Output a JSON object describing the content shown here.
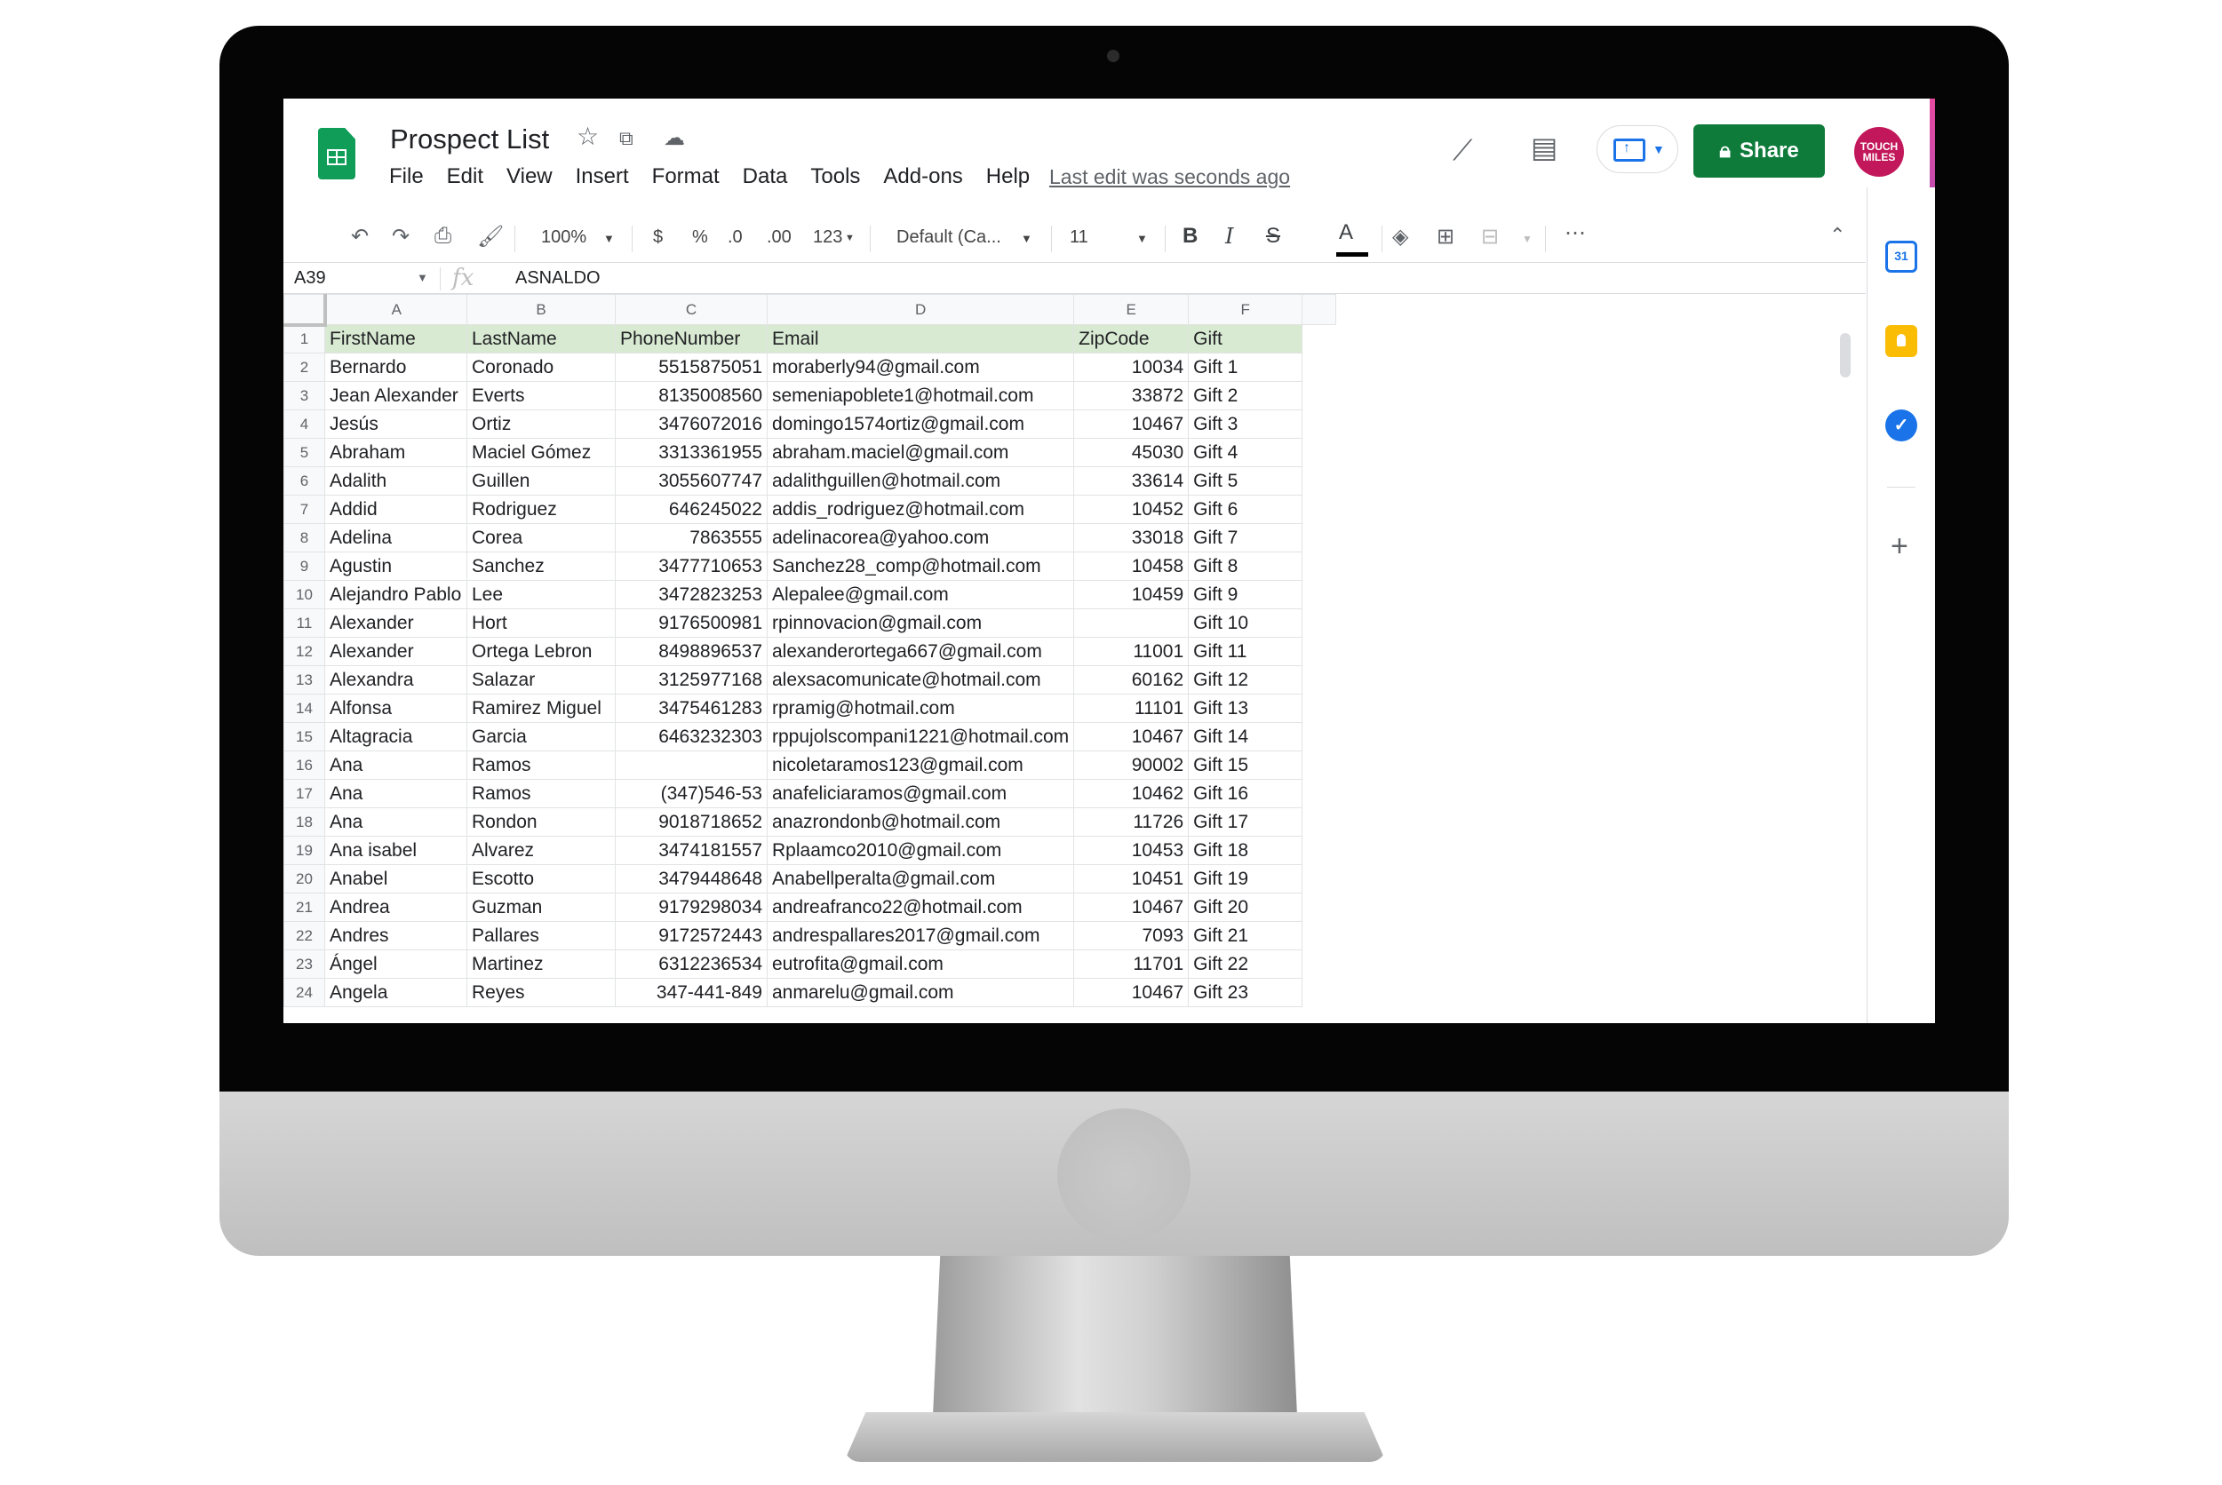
{
  "app": {
    "title": "Prospect List",
    "menu": [
      "File",
      "Edit",
      "View",
      "Insert",
      "Format",
      "Data",
      "Tools",
      "Add-ons",
      "Help"
    ],
    "last_edit": "Last edit was seconds ago",
    "share_label": "Share",
    "avatar_text": "TOUCH MILES"
  },
  "toolbar": {
    "zoom": "100%",
    "currency": "$",
    "percent": "%",
    "decrease_decimal": ".0",
    "increase_decimal": ".00",
    "number_format": "123",
    "font": "Default (Ca...",
    "font_size": "11",
    "bold": "B",
    "italic": "I",
    "strike": "S",
    "text_color": "A",
    "more": "⋯"
  },
  "formula": {
    "cell_ref": "A39",
    "fx": "fx",
    "value": "ASNALDO"
  },
  "columns": [
    "A",
    "B",
    "C",
    "D",
    "E",
    "F"
  ],
  "header_row": [
    "FirstName",
    "LastName",
    "PhoneNumber",
    "Email",
    "ZipCode",
    "Gift"
  ],
  "rows": [
    [
      "2",
      " Bernardo",
      "Coronado",
      "5515875051",
      "moraberly94@gmail.com",
      "10034",
      "Gift 1"
    ],
    [
      "3",
      " Jean Alexander",
      "Everts",
      "8135008560",
      "semeniapoblete1@hotmail.com",
      "33872",
      "Gift 2"
    ],
    [
      "4",
      " Jesús",
      "Ortiz",
      "3476072016",
      "domingo1574ortiz@gmail.com",
      "10467",
      "Gift 3"
    ],
    [
      "5",
      "Abraham",
      "Maciel Gómez",
      "3313361955",
      "abraham.maciel@gmail.com",
      "45030",
      "Gift 4"
    ],
    [
      "6",
      "Adalith",
      "Guillen",
      "3055607747",
      "adalithguillen@hotmail.com",
      "33614",
      "Gift 5"
    ],
    [
      "7",
      "Addid",
      "Rodriguez",
      "646245022",
      "addis_rodriguez@hotmail.com",
      "10452",
      "Gift 6"
    ],
    [
      "8",
      "Adelina",
      "Corea",
      "7863555",
      "adelinacorea@yahoo.com",
      "33018",
      "Gift 7"
    ],
    [
      "9",
      "Agustin",
      "Sanchez",
      "3477710653",
      "Sanchez28_comp@hotmail.com",
      "10458",
      "Gift 8"
    ],
    [
      "10",
      "Alejandro Pablo",
      "Lee",
      "3472823253",
      "Alepalee@gmail.com",
      "10459",
      "Gift 9"
    ],
    [
      "11",
      "Alexander",
      "Hort",
      "9176500981",
      "rpinnovacion@gmail.com",
      "",
      "Gift 10"
    ],
    [
      "12",
      "Alexander",
      "Ortega Lebron",
      "8498896537",
      "alexanderortega667@gmail.com",
      "11001",
      "Gift 11"
    ],
    [
      "13",
      "Alexandra",
      "Salazar",
      "3125977168",
      "alexsacomunicate@hotmail.com",
      "60162",
      "Gift 12"
    ],
    [
      "14",
      "Alfonsa",
      "Ramirez Miguel",
      "3475461283",
      "rpramig@hotmail.com",
      "11101",
      "Gift 13"
    ],
    [
      "15",
      "Altagracia",
      "Garcia",
      "6463232303",
      "rppujolscompani1221@hotmail.com",
      "10467",
      "Gift 14"
    ],
    [
      "16",
      "Ana",
      "Ramos",
      "",
      "nicoletaramos123@gmail.com",
      "90002",
      "Gift 15"
    ],
    [
      "17",
      "Ana",
      "Ramos",
      "(347)546-53",
      "anafeliciaramos@gmail.com",
      "10462",
      "Gift 16"
    ],
    [
      "18",
      "Ana",
      "Rondon",
      "9018718652",
      "anazrondonb@hotmail.com",
      "11726",
      "Gift 17"
    ],
    [
      "19",
      "Ana isabel",
      "Alvarez",
      "3474181557",
      "Rplaamco2010@gmail.com",
      "10453",
      "Gift 18"
    ],
    [
      "20",
      "Anabel",
      "Escotto",
      "3479448648",
      "Anabellperalta@gmail.com",
      "10451",
      "Gift 19"
    ],
    [
      "21",
      "Andrea",
      "Guzman",
      "9179298034",
      "andreafranco22@hotmail.com",
      "10467",
      "Gift 20"
    ],
    [
      "22",
      "Andres",
      "Pallares",
      "9172572443",
      "andrespallares2017@gmail.com",
      "7093",
      "Gift 21"
    ],
    [
      "23",
      "Ángel",
      "Martinez",
      "6312236534",
      "eutrofita@gmail.com",
      "11701",
      "Gift 22"
    ],
    [
      "24",
      "Angela",
      "Reyes",
      "347-441-849",
      "anmarelu@gmail.com",
      "10467",
      "Gift 23"
    ]
  ],
  "side_panel": {
    "calendar_text": "31",
    "tasks_text": "✓",
    "add_text": "+"
  },
  "colors": {
    "share_green": "#0f7b3b",
    "header_row_fill": "#d9ead3",
    "sheets_green": "#0f9d58"
  }
}
